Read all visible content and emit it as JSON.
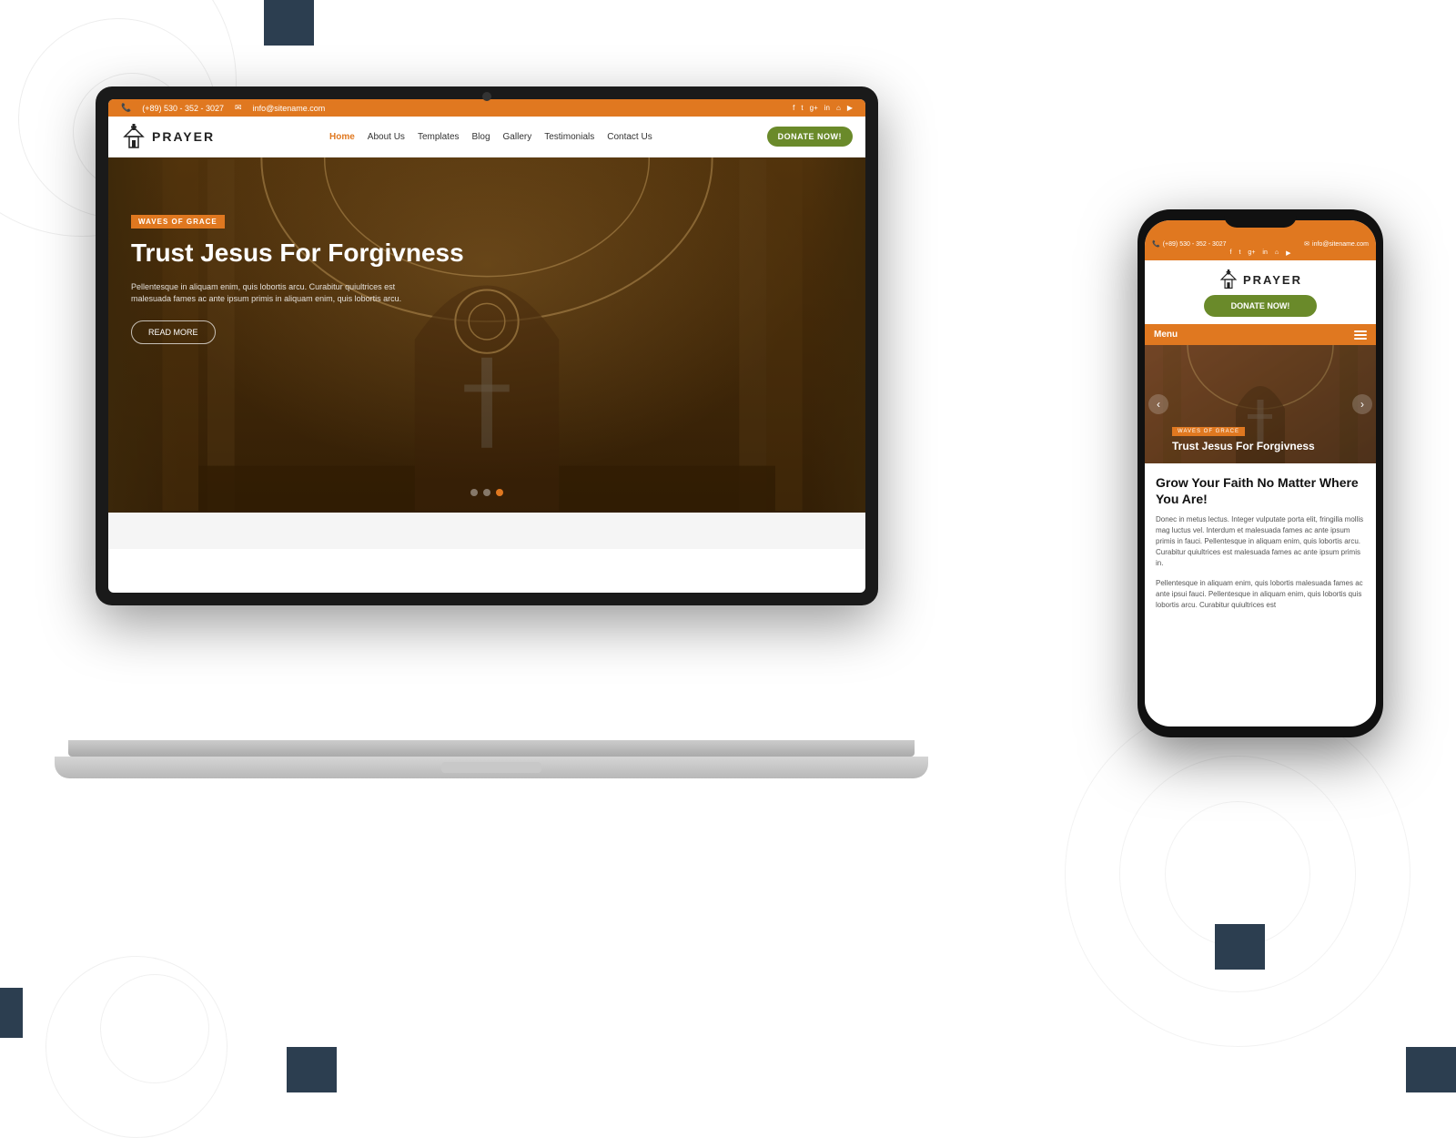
{
  "background": {
    "color": "#ffffff"
  },
  "laptop": {
    "website": {
      "topbar": {
        "phone": "(+89) 530 - 352 - 3027",
        "email": "info@sitename.com",
        "social_icons": [
          "f",
          "t",
          "g+",
          "in",
          "rss",
          "yt"
        ]
      },
      "nav": {
        "logo_text": "PRAYER",
        "links": [
          "Home",
          "About Us",
          "Templates",
          "Blog",
          "Gallery",
          "Testimonials",
          "Contact Us"
        ],
        "active_link": "Home",
        "donate_label": "DONATE NOW!"
      },
      "hero": {
        "badge": "WAVES OF GRACE",
        "title": "Trust Jesus For Forgivness",
        "text": "Pellentesque in aliquam enim, quis lobortis arcu. Curabitur quiultrices est malesuada fames ac ante ipsum primis in aliquam enim, quis lobortis arcu.",
        "button_label": "READ MORE",
        "dots": [
          1,
          2,
          3
        ],
        "active_dot": 2
      }
    }
  },
  "phone": {
    "website": {
      "topbar": {
        "phone": "(+89) 530 - 352 - 3027",
        "email": "info@sitename.com",
        "social_icons": [
          "f",
          "t",
          "g+",
          "in",
          "rss",
          "yt"
        ]
      },
      "logo_text": "PRAYER",
      "donate_label": "DONATE NOW!",
      "menu_label": "Menu",
      "hero": {
        "badge": "WAVES OF GRACE",
        "title": "Trust Jesus For Forgivness"
      },
      "content": {
        "title": "Grow Your Faith No Matter Where You Are!",
        "text1": "Donec in metus lectus. Integer vulputate porta elit, fringilla mollis mag luctus vel. Interdum et malesuada fames ac ante ipsum primis in fauci. Pellentesque in aliquam enim, quis lobortis arcu. Curabitur quiultrices est malesuada fames ac ante ipsum primis in.",
        "text2": "Pellentesque in aliquam enim, quis lobortis malesuada fames ac ante ipsui fauci. Pellentesque in aliquam enim, quis lobortis quis lobortis arcu. Curabitur quiultrices est"
      }
    }
  }
}
